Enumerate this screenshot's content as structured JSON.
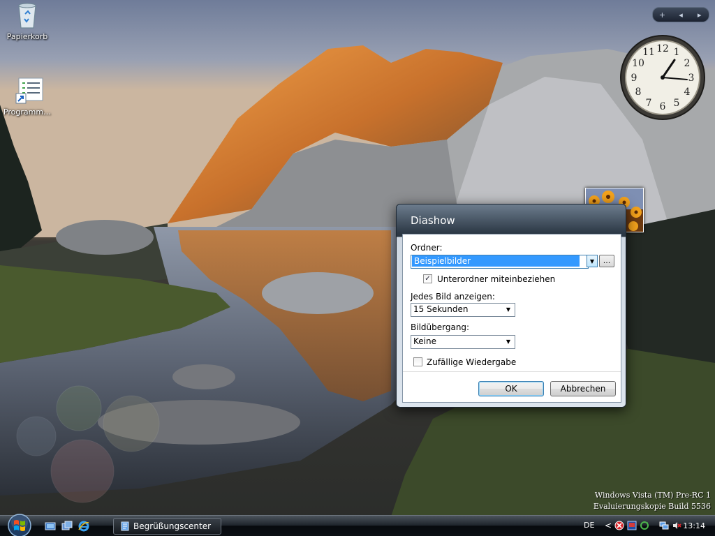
{
  "desktop": {
    "icons": [
      {
        "label": "Papierkorb"
      },
      {
        "label": "Programm…"
      }
    ]
  },
  "sidebar": {
    "controls": {
      "add": "+",
      "prev": "◂",
      "next": "▸"
    }
  },
  "dialog": {
    "title": "Diashow",
    "folder_label": "Ordner:",
    "folder_value": "Beispielbilder",
    "browse_label": "...",
    "include_subfolders_label": "Unterordner miteinbeziehen",
    "include_subfolders_checked": true,
    "show_each_label": "Jedes Bild anzeigen:",
    "show_each_value": "15 Sekunden",
    "transition_label": "Bildübergang:",
    "transition_value": "Keine",
    "shuffle_label": "Zufällige Wiedergabe",
    "shuffle_checked": false,
    "ok_label": "OK",
    "cancel_label": "Abbrechen"
  },
  "watermark": {
    "line1": "Windows Vista (TM) Pre-RC 1",
    "line2": "Evaluierungskopie Build 5536"
  },
  "taskbar": {
    "task_label": "Begrüßungscenter",
    "language": "DE",
    "time": "13:14",
    "tray_chevron": "<"
  },
  "colors": {
    "accent": "#3399ff",
    "dialog_title_bg": "#2d3946"
  }
}
